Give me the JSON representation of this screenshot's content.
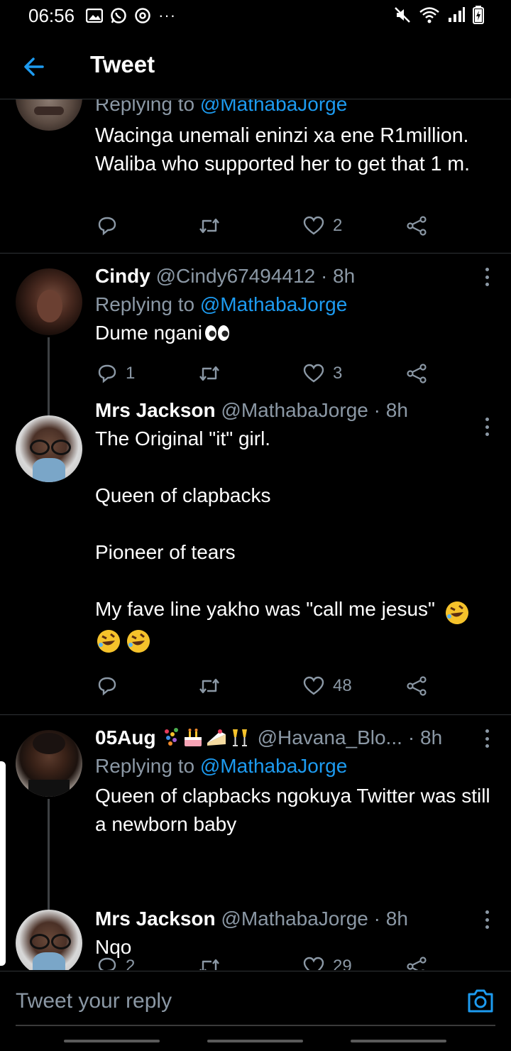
{
  "status_bar": {
    "time": "06:56",
    "icons": [
      "image-icon",
      "whatsapp-icon",
      "chrome-icon",
      "more-dots-icon"
    ],
    "right_icons": [
      "mute-icon",
      "wifi-icon",
      "signal-icon",
      "battery-icon"
    ],
    "more": "···"
  },
  "app_bar": {
    "title": "Tweet",
    "back_icon": "back-arrow-icon"
  },
  "tweets": [
    {
      "replying_prefix": "Replying to",
      "mention": "@MathabaJorge",
      "text": "Wacinga unemali eninzi xa ene R1million. Waliba who supported her to get that 1 m.",
      "replies": "",
      "retweets": "",
      "likes": "2"
    },
    {
      "name": "Cindy",
      "handle": "@Cindy67494412",
      "time": "· 8h",
      "replying_prefix": "Replying to",
      "mention": "@MathabaJorge",
      "text": "Dume ngani",
      "text_emoji": "eyes-emoji",
      "replies": "1",
      "retweets": "",
      "likes": "3"
    },
    {
      "name": "Mrs Jackson",
      "handle": "@MathabaJorge",
      "time": "· 8h",
      "text": "The Original \"it\" girl.\n\nQueen of clapbacks\n\nPioneer of tears\n\nMy fave line yakho was \"call me jesus\"",
      "text_emoji": "rofl-emoji",
      "replies": "",
      "retweets": "",
      "likes": "48"
    },
    {
      "name": "05Aug",
      "name_emojis": [
        "confetti-emoji",
        "cake-emoji",
        "cake-slice-emoji",
        "champagne-emoji"
      ],
      "handle": "@Havana_Blo...",
      "time": "· 8h",
      "replying_prefix": "Replying to",
      "mention": "@MathabaJorge",
      "text": "Queen of clapbacks ngokuya Twitter was still a newborn baby",
      "replies": "2",
      "retweets": "",
      "likes": "29"
    },
    {
      "name": "Mrs Jackson",
      "handle": "@MathabaJorge",
      "time": "· 8h",
      "text": "Nqo"
    }
  ],
  "reply_box": {
    "placeholder": "Tweet your reply",
    "camera_icon": "camera-icon"
  },
  "colors": {
    "accent": "#1d9bf0",
    "secondary_text": "#8b98a5",
    "background": "#000000",
    "divider": "#2f3336"
  }
}
